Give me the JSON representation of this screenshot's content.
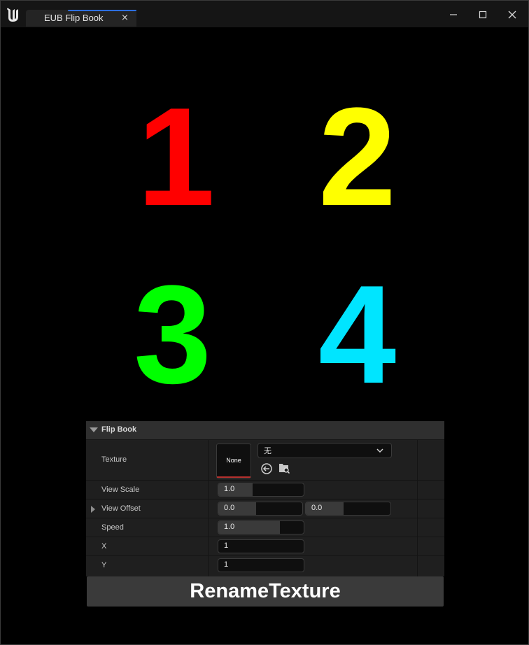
{
  "window": {
    "tab_title": "EUB Flip Book",
    "tab_close": "×"
  },
  "viewport": {
    "digits": [
      {
        "text": "1",
        "color": "#ff0000"
      },
      {
        "text": "2",
        "color": "#ffff00"
      },
      {
        "text": "3",
        "color": "#00ff00"
      },
      {
        "text": "4",
        "color": "#00e5ff"
      }
    ]
  },
  "panel": {
    "title": "Flip Book",
    "texture": {
      "label": "Texture",
      "thumbnail_text": "None",
      "combo_value": "无",
      "icons": [
        "use-selected-asset-icon",
        "browse-asset-icon"
      ]
    },
    "view_scale": {
      "label": "View Scale",
      "value": "1.0",
      "fill_fraction": 0.4
    },
    "view_offset": {
      "label": "View Offset",
      "x": "0.0",
      "y": "0.0",
      "fill_fraction": 0.45
    },
    "speed": {
      "label": "Speed",
      "value": "1.0",
      "fill_fraction": 0.72
    },
    "x": {
      "label": "X",
      "value": "1"
    },
    "y": {
      "label": "Y",
      "value": "1"
    }
  },
  "rename_button": {
    "label": "RenameTexture"
  },
  "colors": {
    "tab_accent": "#2d6fe0",
    "thumbnail_bar": "#b5302d"
  }
}
